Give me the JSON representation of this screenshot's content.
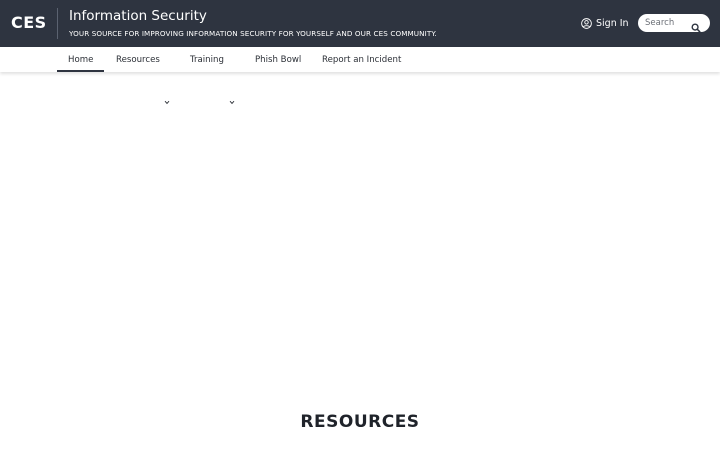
{
  "header": {
    "logo": "CES",
    "title": "Information Security",
    "subtitle": "YOUR SOURCE FOR IMPROVING INFORMATION SECURITY FOR YOURSELF AND OUR CES COMMUNITY.",
    "sign_in_label": "Sign In",
    "search_placeholder": "Search",
    "background_color": "#2e3440"
  },
  "nav": {
    "items": [
      {
        "label": "Home",
        "active": true
      },
      {
        "label": "Resources",
        "has_dropdown": true
      },
      {
        "label": "Training",
        "has_dropdown": true
      },
      {
        "label": "Phish Bowl"
      },
      {
        "label": "Report an Incident"
      }
    ]
  },
  "main": {
    "section_heading": "RESOURCES"
  }
}
